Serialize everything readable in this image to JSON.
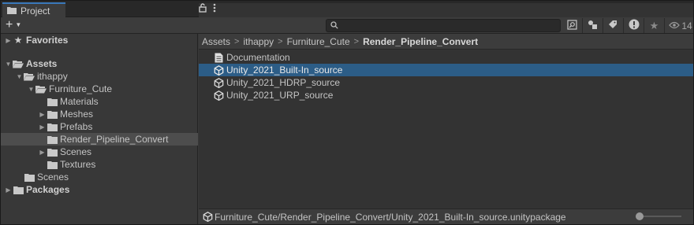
{
  "window": {
    "tab_label": "Project",
    "lock_icon": "lock-icon",
    "menu_icon": "kebab-menu-icon"
  },
  "toolbar": {
    "add_label": "+",
    "search_placeholder": "",
    "hidden_count": "14"
  },
  "tree": [
    {
      "label": "Favorites",
      "bold": true,
      "arrow": "▶",
      "icon": "star-icon"
    },
    {
      "label": "Assets",
      "bold": true,
      "arrow": "▼",
      "icon": "folder-open-icon"
    },
    {
      "label": "ithappy",
      "bold": false,
      "arrow": "▼",
      "icon": "folder-open-icon"
    },
    {
      "label": "Furniture_Cute",
      "bold": false,
      "arrow": "▼",
      "icon": "folder-open-icon"
    },
    {
      "label": "Materials",
      "bold": false,
      "arrow": "",
      "icon": "folder-icon"
    },
    {
      "label": "Meshes",
      "bold": false,
      "arrow": "▶",
      "icon": "folder-icon"
    },
    {
      "label": "Prefabs",
      "bold": false,
      "arrow": "▶",
      "icon": "folder-icon"
    },
    {
      "label": "Render_Pipeline_Convert",
      "bold": false,
      "arrow": "",
      "icon": "folder-icon",
      "selected": true
    },
    {
      "label": "Scenes",
      "bold": false,
      "arrow": "▶",
      "icon": "folder-icon"
    },
    {
      "label": "Textures",
      "bold": false,
      "arrow": "",
      "icon": "folder-icon"
    },
    {
      "label": "Scenes",
      "bold": false,
      "arrow": "",
      "icon": "folder-icon"
    },
    {
      "label": "Packages",
      "bold": true,
      "arrow": "▶",
      "icon": "folder-icon"
    }
  ],
  "breadcrumb": [
    "Assets",
    "ithappy",
    "Furniture_Cute",
    "Render_Pipeline_Convert"
  ],
  "assets": [
    {
      "label": "Documentation",
      "icon": "document-icon"
    },
    {
      "label": "Unity_2021_Built-In_source",
      "icon": "package-icon",
      "selected": true
    },
    {
      "label": "Unity_2021_HDRP_source",
      "icon": "package-icon"
    },
    {
      "label": "Unity_2021_URP_source",
      "icon": "package-icon"
    }
  ],
  "status": {
    "path": "Furniture_Cute/Render_Pipeline_Convert/Unity_2021_Built-In_source.unitypackage"
  },
  "zoom": {
    "value": 0
  }
}
